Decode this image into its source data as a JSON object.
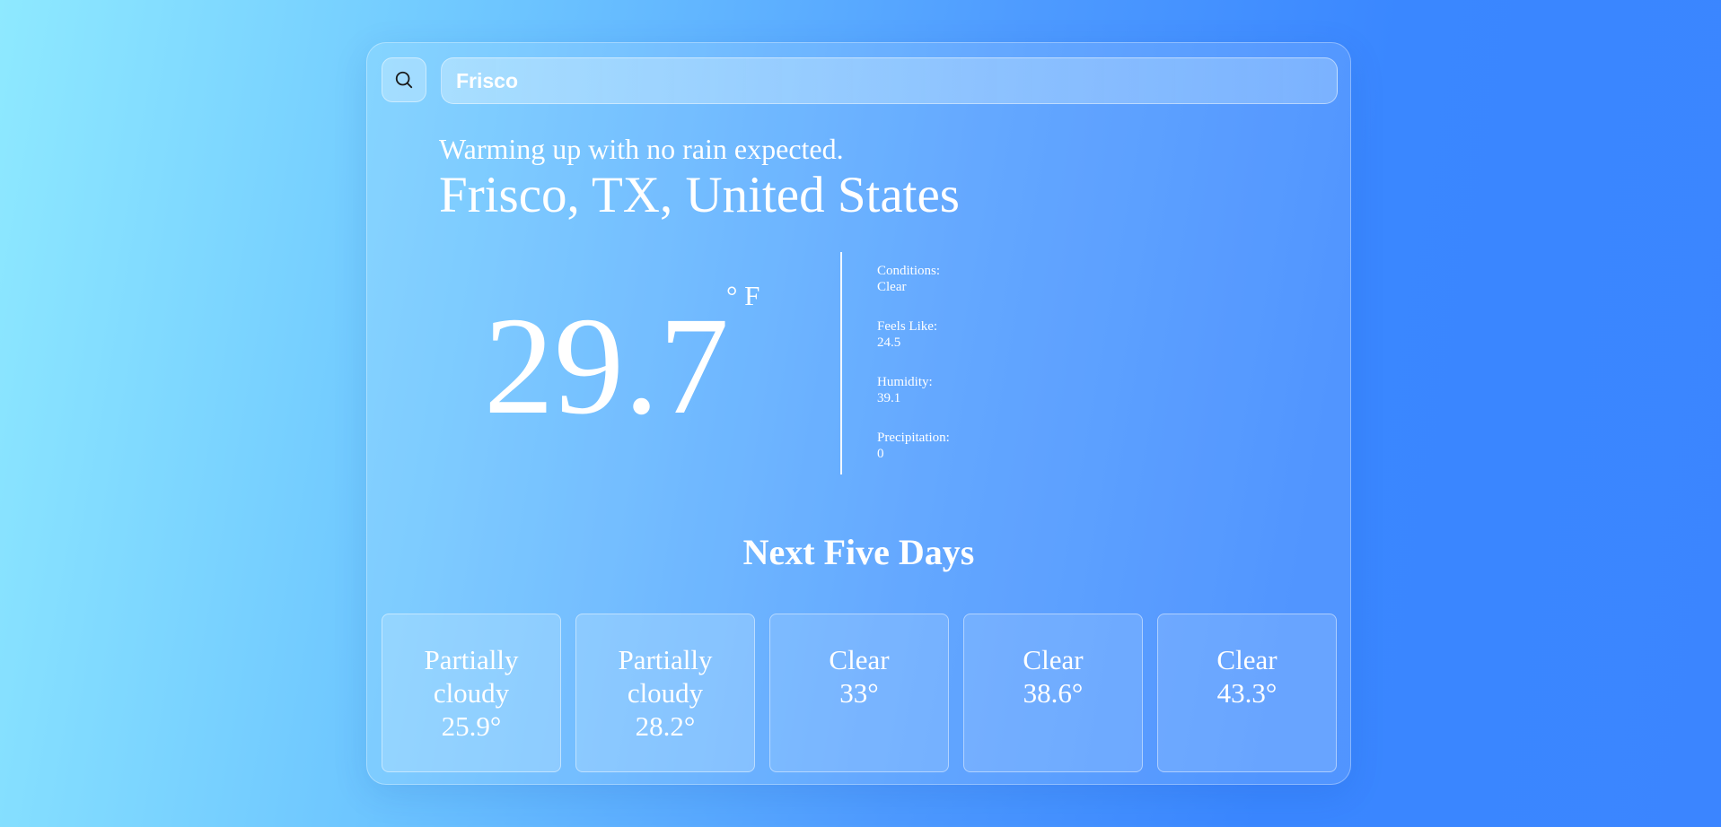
{
  "search": {
    "value": "Frisco",
    "icon": "search-icon"
  },
  "current": {
    "summary": "Warming up with no rain expected.",
    "location": "Frisco, TX, United States",
    "temperature": "29.7",
    "unit": "° F",
    "details": [
      {
        "label": "Conditions:",
        "value": "Clear"
      },
      {
        "label": "Feels Like:",
        "value": "24.5"
      },
      {
        "label": "Humidity:",
        "value": "39.1"
      },
      {
        "label": "Precipitation:",
        "value": "0"
      }
    ]
  },
  "forecast": {
    "title": "Next Five Days",
    "days": [
      {
        "conditions_line1": "Partially",
        "conditions_line2": "cloudy",
        "temp": "25.9°"
      },
      {
        "conditions_line1": "Partially",
        "conditions_line2": "cloudy",
        "temp": "28.2°"
      },
      {
        "conditions_line1": "Clear",
        "conditions_line2": "",
        "temp": "33°"
      },
      {
        "conditions_line1": "Clear",
        "conditions_line2": "",
        "temp": "38.6°"
      },
      {
        "conditions_line1": "Clear",
        "conditions_line2": "",
        "temp": "43.3°"
      }
    ]
  },
  "colors": {
    "background_start": "#8ee9ff",
    "background_end": "#3b85ff",
    "text": "#ffffff"
  }
}
